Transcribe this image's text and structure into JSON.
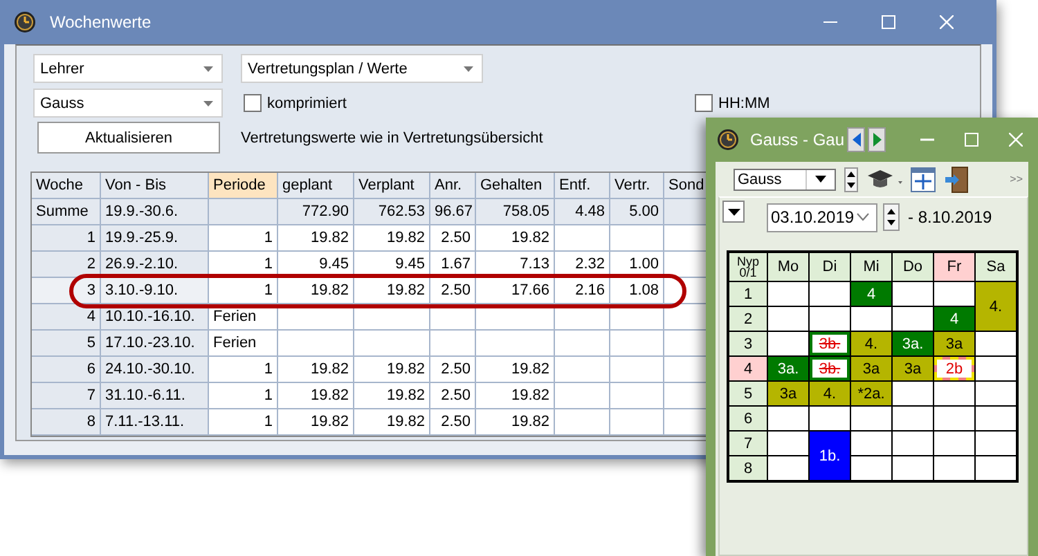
{
  "main_window": {
    "title": "Wochenwerte",
    "dropdowns": [
      {
        "value": "Lehrer"
      },
      {
        "value": "Vertretungsplan / Werte"
      },
      {
        "value": "Gauss"
      }
    ],
    "checkboxes": [
      {
        "label": "komprimiert",
        "checked": false
      },
      {
        "label": "HH:MM",
        "checked": false
      }
    ],
    "refresh_button": "Aktualisieren",
    "info_text": "Vertretungswerte wie in Vertretungsübersicht",
    "table": {
      "columns": [
        {
          "label": "Woche",
          "highlighted": false
        },
        {
          "label": "Von - Bis",
          "highlighted": false
        },
        {
          "label": "Periode",
          "highlighted": true
        },
        {
          "label": "geplant",
          "highlighted": false
        },
        {
          "label": "Verplant",
          "highlighted": false
        },
        {
          "label": "Anr.",
          "highlighted": false
        },
        {
          "label": "Gehalten",
          "highlighted": false
        },
        {
          "label": "Entf.",
          "highlighted": false
        },
        {
          "label": "Vertr.",
          "highlighted": false
        },
        {
          "label": "Sond",
          "highlighted": false
        }
      ],
      "rows": [
        {
          "kind": "total",
          "highlighted": false,
          "cells": [
            "Summe",
            "19.9.-30.6.",
            null,
            "772.90",
            "762.53",
            "96.67",
            "758.05",
            "4.48",
            "5.00"
          ]
        },
        {
          "kind": "week",
          "highlighted": false,
          "cells": [
            "1",
            "19.9.-25.9.",
            "1",
            "19.82",
            "19.82",
            "2.50",
            "19.82"
          ]
        },
        {
          "kind": "week",
          "highlighted": false,
          "cells": [
            "2",
            "26.9.-2.10.",
            "1",
            "9.45",
            "9.45",
            "1.67",
            "7.13",
            "2.32",
            "1.00"
          ]
        },
        {
          "kind": "week",
          "highlighted": true,
          "cells": [
            "3",
            "3.10.-9.10.",
            "1",
            "19.82",
            "19.82",
            "2.50",
            "17.66",
            "2.16",
            "1.08"
          ]
        },
        {
          "kind": "holiday",
          "highlighted": false,
          "cells": [
            "4",
            "10.10.-16.10.",
            "Ferien"
          ]
        },
        {
          "kind": "holiday",
          "highlighted": false,
          "cells": [
            "5",
            "17.10.-23.10.",
            "Ferien"
          ]
        },
        {
          "kind": "week",
          "highlighted": false,
          "cells": [
            "6",
            "24.10.-30.10.",
            "1",
            "19.82",
            "19.82",
            "2.50",
            "19.82"
          ]
        },
        {
          "kind": "week",
          "highlighted": false,
          "cells": [
            "7",
            "31.10.-6.11.",
            "1",
            "19.82",
            "19.82",
            "2.50",
            "19.82"
          ]
        },
        {
          "kind": "week",
          "highlighted": false,
          "cells": [
            "8",
            "7.11.-13.11.",
            "1",
            "19.82",
            "19.82",
            "2.50",
            "19.82"
          ]
        }
      ]
    }
  },
  "timetable_window": {
    "title": "Gauss - Gau",
    "teacher_dropdown": {
      "value": "Gauss"
    },
    "toolbar_overflow": ">>",
    "date_field": {
      "value": "03.10.2019"
    },
    "date_end": "- 8.10.2019",
    "corner_label": "Nyp 0/1",
    "days": [
      {
        "label": "Mo",
        "highlighted": false
      },
      {
        "label": "Di",
        "highlighted": false
      },
      {
        "label": "Mi",
        "highlighted": false
      },
      {
        "label": "Do",
        "highlighted": false
      },
      {
        "label": "Fr",
        "highlighted": true
      },
      {
        "label": "Sa",
        "highlighted": false
      }
    ],
    "periods": [
      {
        "label": "1",
        "highlighted": false,
        "cells": [
          {
            "kind": "empty"
          },
          {
            "kind": "empty"
          },
          {
            "kind": "lesson",
            "text": "4",
            "color": "#007a00"
          },
          {
            "kind": "empty"
          },
          {
            "kind": "empty"
          },
          {
            "kind": "lesson",
            "text": "4.",
            "color": "#b5b500"
          }
        ]
      },
      {
        "label": "2",
        "highlighted": false,
        "cells": [
          {
            "kind": "empty"
          },
          {
            "kind": "empty"
          },
          {
            "kind": "empty"
          },
          {
            "kind": "empty"
          },
          {
            "kind": "lesson",
            "text": "4",
            "color": "#007a00"
          },
          {
            "kind": "merged"
          }
        ]
      },
      {
        "label": "3",
        "highlighted": false,
        "cells": [
          {
            "kind": "empty"
          },
          {
            "kind": "cancelled",
            "text": "3b."
          },
          {
            "kind": "lesson",
            "text": "4.",
            "color": "#b5b500"
          },
          {
            "kind": "lesson",
            "text": "3a.",
            "color": "#007a00"
          },
          {
            "kind": "lesson",
            "text": "3a",
            "color": "#b5b500"
          },
          {
            "kind": "empty"
          }
        ]
      },
      {
        "label": "4",
        "highlighted": true,
        "cells": [
          {
            "kind": "lesson",
            "text": "3a.",
            "color": "#007a00"
          },
          {
            "kind": "cancelled",
            "text": "3b."
          },
          {
            "kind": "lesson",
            "text": "3a",
            "color": "#b5b500"
          },
          {
            "kind": "lesson",
            "text": "3a",
            "color": "#b5b500"
          },
          {
            "kind": "marked",
            "text": "2b"
          },
          {
            "kind": "empty"
          }
        ]
      },
      {
        "label": "5",
        "highlighted": false,
        "cells": [
          {
            "kind": "lesson",
            "text": "3a",
            "color": "#b5b500"
          },
          {
            "kind": "lesson",
            "text": "4.",
            "color": "#b5b500"
          },
          {
            "kind": "lesson",
            "text": "*2a.",
            "color": "#b5b500"
          },
          {
            "kind": "empty"
          },
          {
            "kind": "empty"
          },
          {
            "kind": "empty"
          }
        ]
      },
      {
        "label": "6",
        "highlighted": false,
        "cells": [
          {
            "kind": "empty"
          },
          {
            "kind": "empty"
          },
          {
            "kind": "empty"
          },
          {
            "kind": "empty"
          },
          {
            "kind": "empty"
          },
          {
            "kind": "empty"
          }
        ]
      },
      {
        "label": "7",
        "highlighted": false,
        "cells": [
          {
            "kind": "empty"
          },
          {
            "kind": "lesson",
            "text": "1b.",
            "color": "#0000ff"
          },
          {
            "kind": "empty"
          },
          {
            "kind": "empty"
          },
          {
            "kind": "empty"
          },
          {
            "kind": "empty"
          }
        ]
      },
      {
        "label": "8",
        "highlighted": false,
        "cells": [
          {
            "kind": "empty"
          },
          {
            "kind": "merged"
          },
          {
            "kind": "empty"
          },
          {
            "kind": "empty"
          },
          {
            "kind": "empty"
          },
          {
            "kind": "empty"
          }
        ]
      }
    ]
  }
}
